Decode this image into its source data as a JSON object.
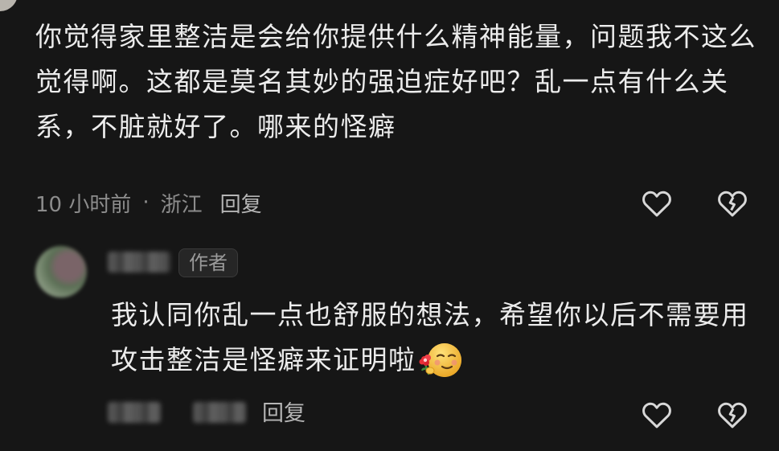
{
  "comment": {
    "text": "你觉得家里整洁是会给你提供什么精神能量，问题我不这么觉得啊。这都是莫名其妙的强迫症好吧？乱一点有什么关系，不脏就好了。哪来的怪癖",
    "time": "10 小时前",
    "separator": "·",
    "location": "浙江",
    "reply_label": "回复"
  },
  "reply": {
    "author_badge": "作者",
    "text": "我认同你乱一点也舒服的想法，希望你以后不需要用攻击整洁是怪癖来证明啦",
    "emoji_icon": "smile-with-flower-emoji",
    "reply_label": "回复"
  },
  "icons": {
    "like": "heart-icon",
    "dislike": "broken-heart-icon"
  },
  "colors": {
    "background": "#161616",
    "text": "#ececec",
    "muted": "#8c8c8c"
  }
}
